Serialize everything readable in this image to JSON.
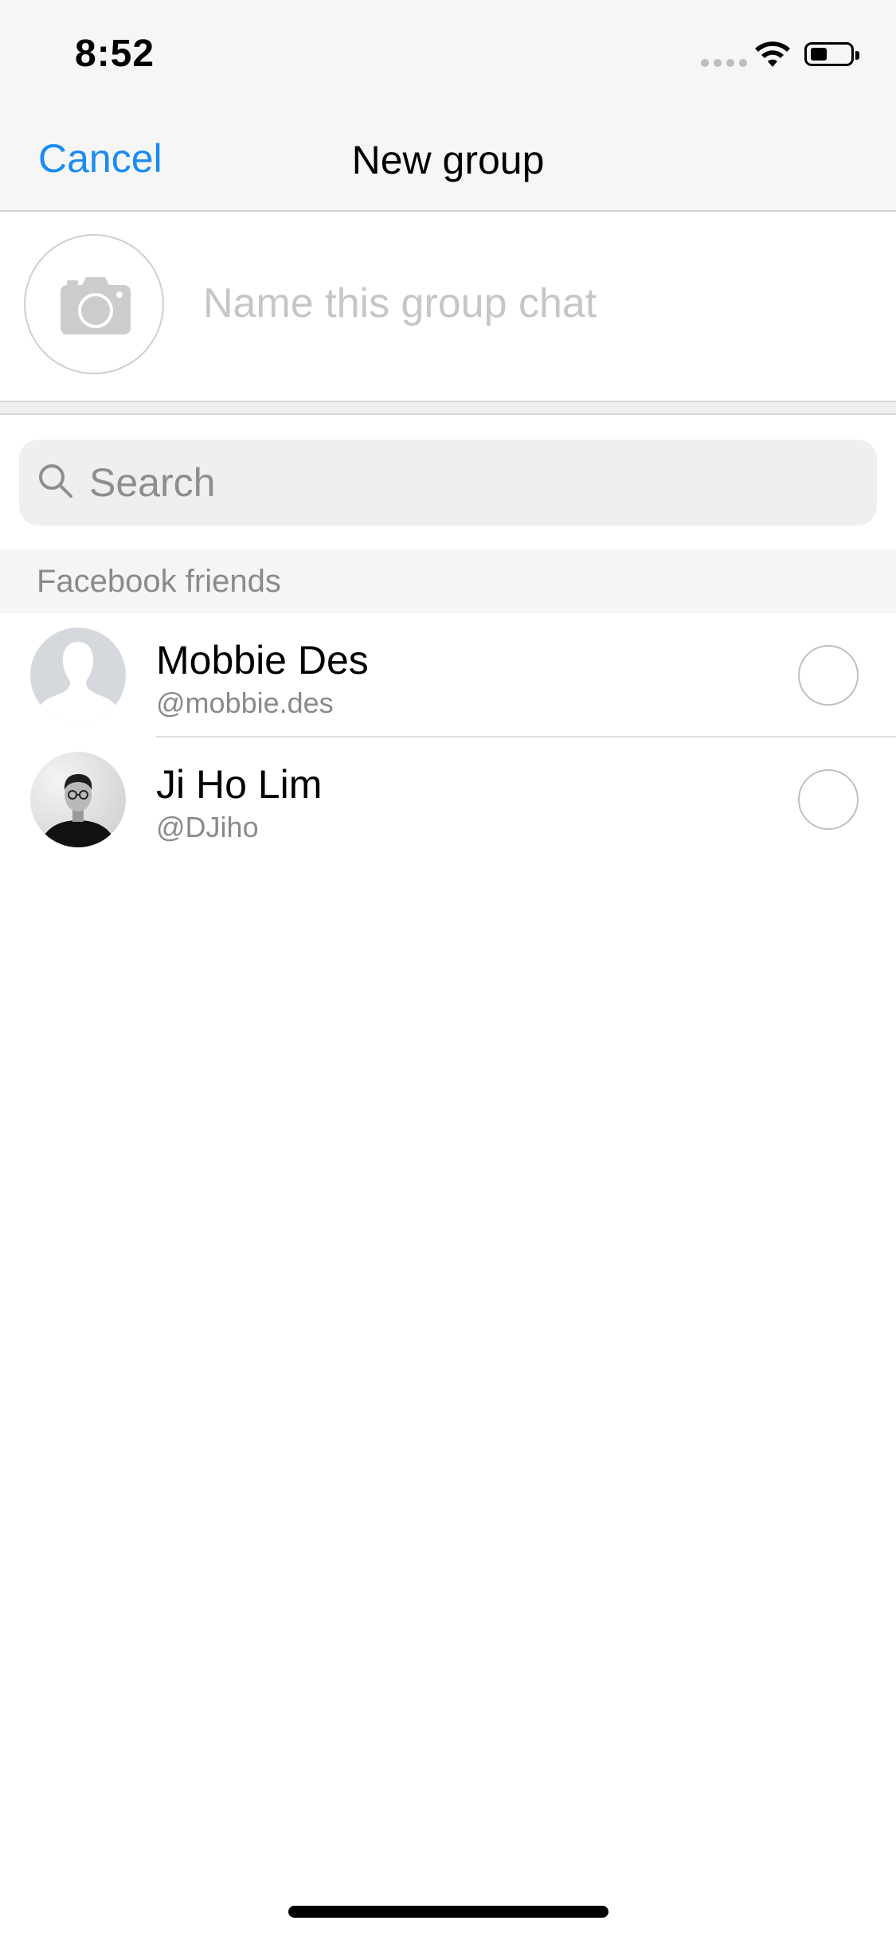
{
  "status_bar": {
    "time": "8:52",
    "icons": [
      "signal-icon",
      "wifi-icon",
      "battery-icon"
    ]
  },
  "nav": {
    "cancel_label": "Cancel",
    "title": "New group",
    "accent_color": "#1b8cf2"
  },
  "group_name": {
    "photo_icon": "camera-icon",
    "placeholder": "Name this group chat",
    "value": ""
  },
  "search": {
    "icon": "search-icon",
    "placeholder": "Search",
    "value": ""
  },
  "friends_section": {
    "title": "Facebook friends",
    "items": [
      {
        "name": "Mobbie Des",
        "handle": "@mobbie.des",
        "avatar": "default-avatar-icon",
        "selected": false
      },
      {
        "name": "Ji Ho Lim",
        "handle": "@DJiho",
        "avatar": "profile-photo",
        "selected": false
      }
    ]
  }
}
